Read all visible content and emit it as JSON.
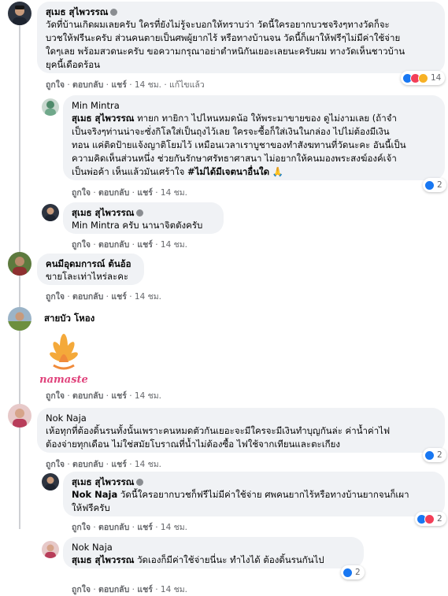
{
  "ui": {
    "like": "ถูกใจ",
    "reply": "ตอบกลับ",
    "share": "แชร์",
    "sep": "·",
    "edited": "แก้ไขแล้ว"
  },
  "comments": [
    {
      "author": "สุเมธ สุไพวรรณ",
      "lines": [
        "วัดที่บ้านเกิดผมเลยครับ ใครที่ยังไม่รู้จะบอกให้ทราบว่า วัดนี้ใครอยากบวชจริงๆทางวัดก็จะ",
        "บวชให้ฟรีนะครับ ส่วนคนตายเป็นศพผู้ยากไร้ หรือทางบ้านจน วัดนี้ก็เผาให้ฟรีๆไม่มีค่าใช้จ่าย",
        "ใดๆเลย พร้อมสวดนะครับ ขอความกรุณาอย่าตำหนิกันเยอะเลยนะครับผม ทางวัดเห็นชาวบ้าน",
        "ยุคนี้เดือดร้อน"
      ],
      "time": "14 ชม.",
      "reactions": {
        "count": "14",
        "icons": [
          "like-icon",
          "love-icon",
          "haha-icon"
        ]
      }
    },
    {
      "author": "Min Mintra",
      "tag": "สุเมธ สุไพวรรณ",
      "lines": [
        " ทายก ทายิกา ไปไหนหมดน้อ ให้พระมาขายของ ดูไม่งามเลย (ถ้าจำ",
        "เป็นจริงๆท่านน่าจะซั่งกิโลใส่เป็นถุงไว้เลย ใครจะซื้อก็ใส่เงินในกล่อง ไปไม่ต้องมีเงิน",
        "ทอน แค่ติดป้ายแจ้งญาติโยมไว้ เหมือนเวลาเราบูชาของทำสังฆทานที่วัดนะคะ อันนี้เป็น",
        "ความคิดเห็นส่วนหนึ่ง ช่วยกันรักษาศรัทธาศาสนา ไม่อยากให้คนมองพระสงฆ์องค์เจ้า",
        "เป็นพ่อค้า เห็นแล้วมันเศร้าใจ "
      ],
      "hashtag": "#ไม่ได้มีเจตนาอื่นใด",
      "emoji": "🙏",
      "time": "14 ชม.",
      "reactions": {
        "count": "2"
      }
    },
    {
      "author": "สุเมธ สุไพวรรณ",
      "line": "Min Mintra ครับ นานาจิตตังครับ",
      "time": "14 ชม."
    },
    {
      "author": "คนมีอุดมการณ์ ต้นอ้อ",
      "line": "ขายโละเท่าไหร่ละคะ",
      "time": "14 ชม."
    },
    {
      "author": "สายบัว โหอง",
      "sticker_text": "namaste",
      "time": "14 ชม."
    },
    {
      "author": "Nok Naja",
      "lines": [
        "เห้อทุกที่ต้องดิ้นรนทั้งนั้นเพราะคนหมดตัวกันเยอะจะมีใครจะมีเงินทำบุญกันล่ะ ค่าน้ำค่าไฟ",
        "ต้องจ่ายทุกเดือน ไม่ใช่สมัยโบราณที่น้ำไม่ต้องซื้อ ไฟใช้จากเทียนและตะเกียง"
      ],
      "time": "14 ชม.",
      "reactions": {
        "count": "2"
      }
    },
    {
      "author": "สุเมธ สุไพวรรณ",
      "tag": "Nok Naja",
      "lines": [
        " วัดนี้ใครอยากบวชก็ฟรีไม่มีค่าใช้จ่าย ศพคนยากไร้หรือทางบ้านยากจนก็เผา",
        "ให้ฟรีครับ"
      ],
      "time": "14 ชม.",
      "reactions": {
        "count": "2"
      }
    },
    {
      "author": "Nok Naja",
      "tag": "สุเมธ สุไพวรรณ",
      "line": " วัดเองก็มีค่าใช้จ่ายนี่นะ ทำไงได้ ต้องดิ้นรนกันไป",
      "time": "14 ชม.",
      "reactions": {
        "count": "2"
      }
    }
  ]
}
